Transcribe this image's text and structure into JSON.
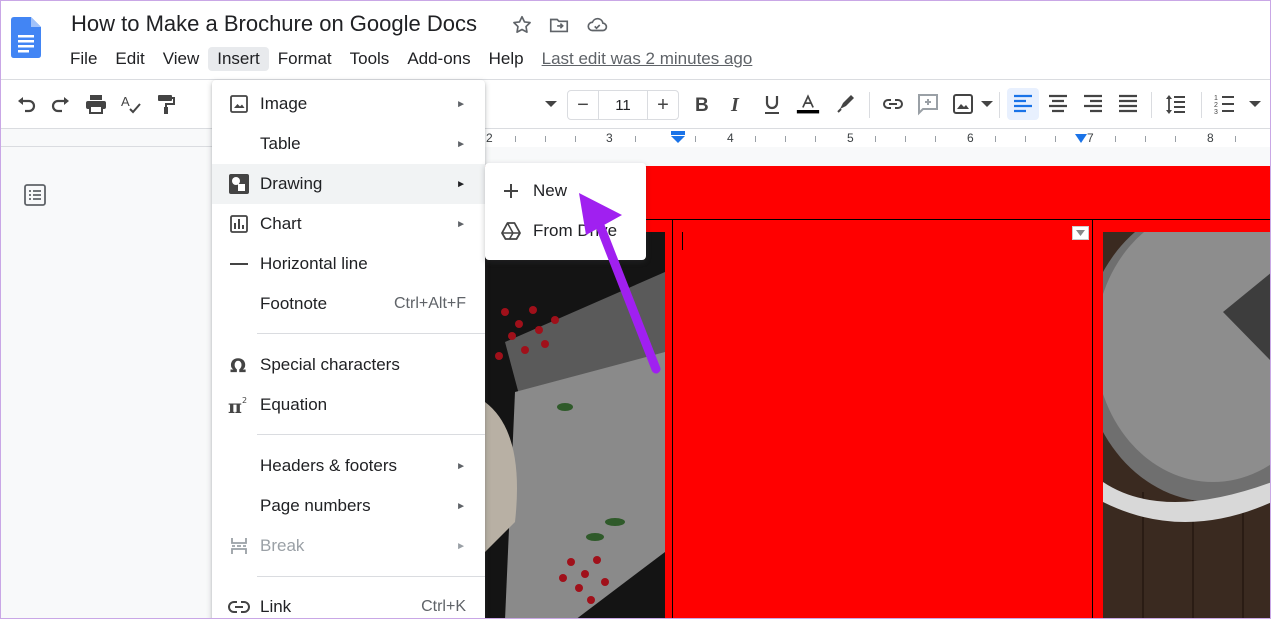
{
  "document": {
    "title": "How to Make a Brochure on Google Docs",
    "last_edit": "Last edit was 2 minutes ago"
  },
  "menubar": {
    "items": [
      "File",
      "Edit",
      "View",
      "Insert",
      "Format",
      "Tools",
      "Add-ons",
      "Help"
    ],
    "active": "Insert"
  },
  "toolbar": {
    "font_size": "11",
    "decrease_label": "−",
    "increase_label": "+",
    "text_color": "#000000"
  },
  "ruler": {
    "numbers": [
      "2",
      "3",
      "4",
      "5",
      "6",
      "7",
      "8"
    ]
  },
  "insert_menu": {
    "items": [
      {
        "label": "Image",
        "icon": "image-icon",
        "submenu": true
      },
      {
        "label": "Table",
        "icon": "",
        "submenu": true
      },
      {
        "label": "Drawing",
        "icon": "drawing-icon",
        "submenu": true,
        "highlighted": true
      },
      {
        "label": "Chart",
        "icon": "chart-icon",
        "submenu": true
      },
      {
        "label": "Horizontal line",
        "icon": "horizontal-line-icon",
        "submenu": false
      },
      {
        "label": "Footnote",
        "icon": "",
        "shortcut": "Ctrl+Alt+F"
      },
      {
        "label": "Special characters",
        "icon": "omega-icon",
        "submenu": false
      },
      {
        "label": "Equation",
        "icon": "pi-icon",
        "submenu": false
      },
      {
        "label": "Headers & footers",
        "icon": "",
        "submenu": true
      },
      {
        "label": "Page numbers",
        "icon": "",
        "submenu": true
      },
      {
        "label": "Break",
        "icon": "break-icon",
        "submenu": true,
        "disabled": true
      },
      {
        "label": "Link",
        "icon": "link-icon",
        "shortcut": "Ctrl+K"
      }
    ],
    "submenu_arrow": "►"
  },
  "drawing_submenu": {
    "items": [
      {
        "label": "New",
        "icon": "plus-icon"
      },
      {
        "label": "From Drive",
        "icon": "drive-icon"
      }
    ]
  },
  "colors": {
    "page_background": "#ff0000",
    "accent": "#1a73e8",
    "annotation_arrow": "#a020f0"
  }
}
